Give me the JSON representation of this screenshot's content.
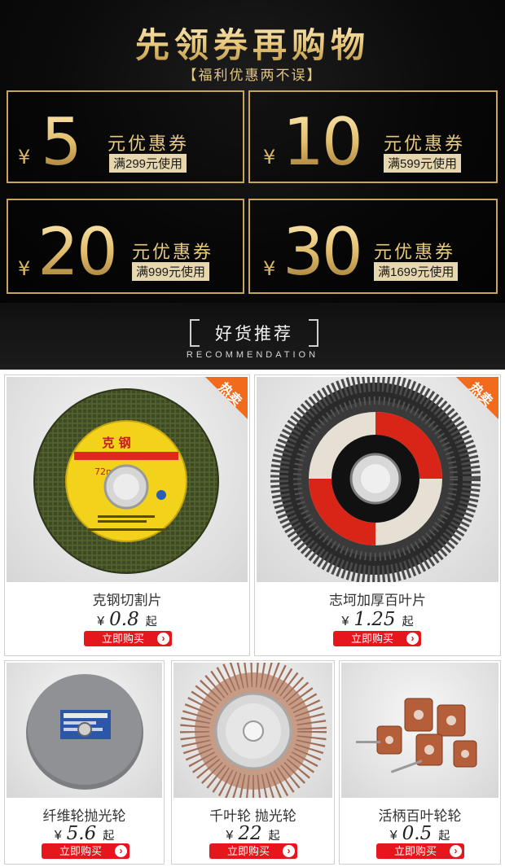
{
  "banner": {
    "title": "先领券再购物",
    "subtitle": "【福利优惠两不误】"
  },
  "coupons": [
    {
      "currency": "¥",
      "amount": "5",
      "label": "元优惠券",
      "condition": "满299元使用"
    },
    {
      "currency": "¥",
      "amount": "10",
      "label": "元优惠券",
      "condition": "满599元使用"
    },
    {
      "currency": "¥",
      "amount": "20",
      "label": "元优惠券",
      "condition": "满999元使用"
    },
    {
      "currency": "¥",
      "amount": "30",
      "label": "元优惠券",
      "condition": "满1699元使用"
    }
  ],
  "recommend": {
    "title": "好货推荐",
    "subtitle": "RECOMMENDATION"
  },
  "hot_badge": "热卖",
  "products": [
    {
      "name": "克钢切割片",
      "currency": "¥",
      "price": "0.8",
      "suffix": "起",
      "button": "立即购买",
      "hot": true
    },
    {
      "name": "志坷加厚百叶片",
      "currency": "¥",
      "price": "1.25",
      "suffix": "起",
      "button": "立即购买",
      "hot": true
    },
    {
      "name": "纤维轮抛光轮",
      "currency": "¥",
      "price": "5.6",
      "suffix": "起",
      "button": "立即购买",
      "hot": false
    },
    {
      "name": "千叶轮 抛光轮",
      "currency": "¥",
      "price": "22",
      "suffix": "起",
      "button": "立即购买",
      "hot": false
    },
    {
      "name": "活柄百叶轮轮",
      "currency": "¥",
      "price": "0.5",
      "suffix": "起",
      "button": "立即购买",
      "hot": false
    }
  ],
  "product_label_text": {
    "disc1_brand": "克 钢",
    "disc1_speed": "72m/s"
  },
  "colors": {
    "gold": "#c9a55b",
    "buy_red": "#e5161c",
    "hot_orange": "#f26b1d"
  }
}
